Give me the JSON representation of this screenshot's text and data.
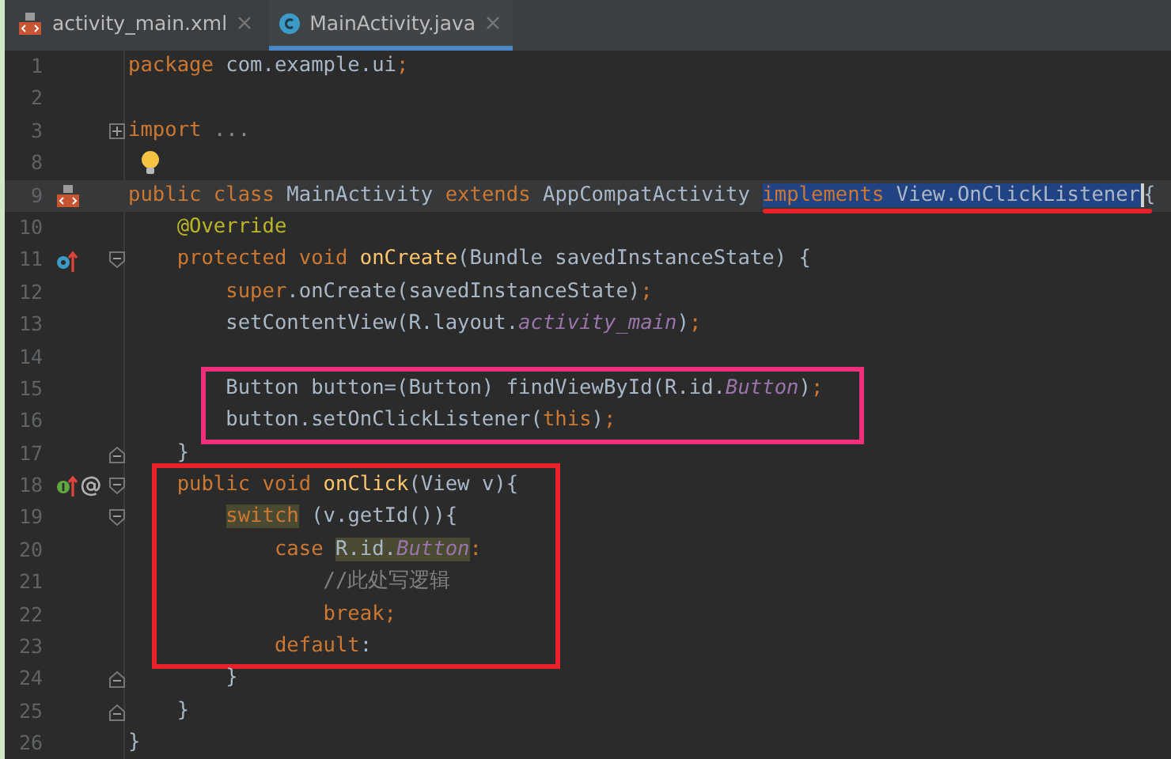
{
  "tabs": [
    {
      "label": "activity_main.xml",
      "kind": "layout",
      "selected": false
    },
    {
      "label": "MainActivity.java",
      "kind": "class",
      "selected": true
    }
  ],
  "lines": [
    {
      "number": "1",
      "tokens": [
        {
          "kind": "keyword",
          "text": "package"
        },
        {
          "kind": "plain",
          "text": " com.example.ui"
        },
        {
          "kind": "keyword",
          "text": ";"
        }
      ]
    },
    {
      "number": "2"
    },
    {
      "number": "3",
      "fold": {
        "kind": "collapsed"
      },
      "tokens": [
        {
          "kind": "keyword",
          "text": "import"
        },
        {
          "kind": "folded",
          "text": " ..."
        }
      ]
    },
    {
      "number": "8",
      "bulb": true
    },
    {
      "number": "9",
      "current": true,
      "gutter_icons": [
        {
          "kind": "layout"
        }
      ],
      "tokens": [
        {
          "kind": "keyword",
          "text": "public class "
        },
        {
          "kind": "plain",
          "text": "MainActivity "
        },
        {
          "kind": "keyword",
          "text": "extends "
        },
        {
          "kind": "plain",
          "text": "AppCompatActivity "
        },
        {
          "kind": "keyword",
          "text": "implements",
          "selected": true,
          "underlined": true
        },
        {
          "kind": "plain",
          "text": " View.OnClickListener",
          "selected": true,
          "underlined": true
        },
        {
          "kind": "plain",
          "text": "{",
          "caret": true,
          "underlined": true
        }
      ]
    },
    {
      "number": "10",
      "tokens": [
        {
          "kind": "annotation",
          "text": "    @Override"
        }
      ]
    },
    {
      "number": "11",
      "gutter_icons": [
        {
          "kind": "override"
        }
      ],
      "fold": {
        "kind": "start"
      },
      "tokens": [
        {
          "kind": "keyword",
          "text": "    protected void "
        },
        {
          "kind": "method",
          "text": "onCreate"
        },
        {
          "kind": "plain",
          "text": "(Bundle savedInstanceState) {"
        }
      ]
    },
    {
      "number": "12",
      "tokens": [
        {
          "kind": "keyword",
          "text": "        super"
        },
        {
          "kind": "plain",
          "text": ".onCreate(savedInstanceState)"
        },
        {
          "kind": "keyword",
          "text": ";"
        }
      ]
    },
    {
      "number": "13",
      "tokens": [
        {
          "kind": "plain",
          "text": "        setContentView(R.layout."
        },
        {
          "kind": "field",
          "text": "activity_main"
        },
        {
          "kind": "plain",
          "text": ")"
        },
        {
          "kind": "keyword",
          "text": ";"
        }
      ]
    },
    {
      "number": "14"
    },
    {
      "number": "15",
      "box": {
        "color": "#f0307a"
      },
      "tokens": [
        {
          "kind": "plain",
          "text": "        Button button=(Button) findViewById(R.id."
        },
        {
          "kind": "field",
          "text": "Button"
        },
        {
          "kind": "plain",
          "text": ")"
        },
        {
          "kind": "keyword",
          "text": ";"
        }
      ]
    },
    {
      "number": "16",
      "box": {
        "color": "#f0307a"
      },
      "tokens": [
        {
          "kind": "plain",
          "text": "        button.setOnClickListener("
        },
        {
          "kind": "keyword",
          "text": "this"
        },
        {
          "kind": "plain",
          "text": ")"
        },
        {
          "kind": "keyword",
          "text": ";"
        }
      ]
    },
    {
      "number": "17",
      "fold": {
        "kind": "end"
      },
      "tokens": [
        {
          "kind": "plain",
          "text": "    }"
        }
      ]
    },
    {
      "number": "18",
      "box": {
        "color": "#e8222a"
      },
      "gutter_icons": [
        {
          "kind": "implement"
        },
        {
          "kind": "annotation"
        }
      ],
      "fold": {
        "kind": "start"
      },
      "tokens": [
        {
          "kind": "keyword",
          "text": "    public void "
        },
        {
          "kind": "method",
          "text": "onClick"
        },
        {
          "kind": "plain",
          "text": "(View v){"
        }
      ]
    },
    {
      "number": "19",
      "box": {
        "color": "#e8222a"
      },
      "fold": {
        "kind": "start"
      },
      "tokens": [
        {
          "kind": "keyword",
          "text": "        switch",
          "highlighted": true
        },
        {
          "kind": "plain",
          "text": " (v.getId()){"
        }
      ]
    },
    {
      "number": "20",
      "box": {
        "color": "#e8222a"
      },
      "tokens": [
        {
          "kind": "keyword",
          "text": "            case "
        },
        {
          "kind": "plain",
          "text": "R.id.",
          "highlighted": true
        },
        {
          "kind": "field",
          "text": "Button",
          "highlighted": true
        },
        {
          "kind": "keyword",
          "text": ":"
        }
      ]
    },
    {
      "number": "21",
      "box": {
        "color": "#e8222a"
      },
      "tokens": [
        {
          "kind": "comment",
          "text": "                //此处写逻辑"
        }
      ]
    },
    {
      "number": "22",
      "box": {
        "color": "#e8222a"
      },
      "tokens": [
        {
          "kind": "keyword",
          "text": "                break;"
        }
      ]
    },
    {
      "number": "23",
      "box": {
        "color": "#e8222a"
      },
      "tokens": [
        {
          "kind": "keyword",
          "text": "            default"
        },
        {
          "kind": "plain",
          "text": ":"
        }
      ]
    },
    {
      "number": "24",
      "fold": {
        "kind": "end"
      },
      "tokens": [
        {
          "kind": "plain",
          "text": "        }"
        }
      ]
    },
    {
      "number": "25",
      "fold": {
        "kind": "end"
      },
      "tokens": [
        {
          "kind": "plain",
          "text": "    }"
        }
      ]
    },
    {
      "number": "26",
      "tokens": [
        {
          "kind": "plain",
          "text": "}"
        }
      ]
    }
  ]
}
